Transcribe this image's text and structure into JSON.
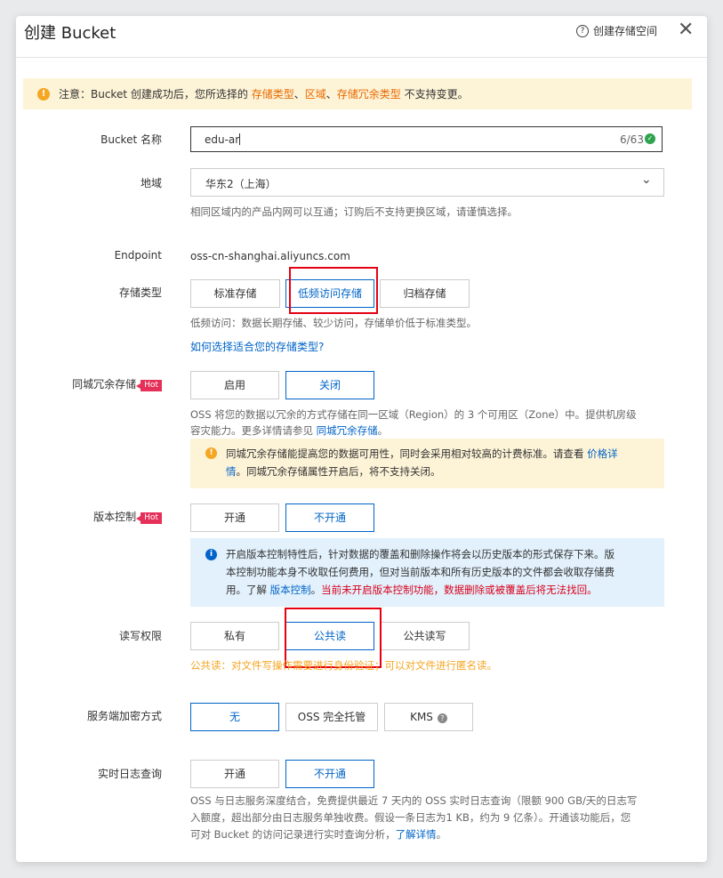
{
  "header": {
    "title": "创建 Bucket",
    "help_icon_glyph": "?",
    "help_label": "创建存储空间",
    "close_glyph": "✕"
  },
  "notice": {
    "prefix": "注意：Bucket 创建成功后，您所选择的 ",
    "field1": "存储类型",
    "sep1": "、",
    "field2": "区域",
    "sep2": "、",
    "field3": "存储冗余类型",
    "suffix": " 不支持变更。"
  },
  "bucket_name": {
    "label": "Bucket 名称",
    "value": "edu-ar",
    "count": "6/63"
  },
  "region": {
    "label": "地域",
    "value": "华东2（上海）",
    "hint": "相同区域内的产品内网可以互通；订购后不支持更换区域，请谨慎选择。"
  },
  "endpoint": {
    "label": "Endpoint",
    "value": "oss-cn-shanghai.aliyuncs.com"
  },
  "storage_class": {
    "label": "存储类型",
    "options": [
      "标准存储",
      "低频访问存储",
      "归档存储"
    ],
    "selected": "低频访问存储",
    "hint": "低频访问：数据长期存储、较少访问，存储单价低于标准类型。",
    "link": "如何选择适合您的存储类型?"
  },
  "redundancy": {
    "label": "同城冗余存储",
    "badge": "Hot",
    "options": [
      "启用",
      "关闭"
    ],
    "selected": "关闭",
    "desc_line1": "OSS 将您的数据以冗余的方式存储在同一区域（Region）的 3 个可用区（Zone）中。提供机房级",
    "desc_line2": "容灾能力。更多详情请参见 ",
    "desc_link": "同城冗余存储",
    "desc_end": "。",
    "tip_line1": "同城冗余存储能提高您的数据可用性，同时会采用相对较高的计费标准。请查看 ",
    "tip_link_a": "价格详",
    "tip_link_b": "情",
    "tip_line2_rest": "。同城冗余存储属性开启后，将不支持关闭。"
  },
  "versioning": {
    "label": "版本控制",
    "badge": "Hot",
    "options": [
      "开通",
      "不开通"
    ],
    "selected": "不开通",
    "info_line1": "开启版本控制特性后，针对数据的覆盖和删除操作将会以历史版本的形式保存下来。版",
    "info_line2": "本控制功能本身不收取任何费用，但对当前版本和所有历史版本的文件都会收取存储费",
    "info_line3_a": "用。了解 ",
    "info_link": "版本控制",
    "info_end": "。",
    "info_red": "当前未开启版本控制功能，数据删除或被覆盖后将无法找回。"
  },
  "acl": {
    "label": "读写权限",
    "options": [
      "私有",
      "公共读",
      "公共读写"
    ],
    "selected": "公共读",
    "warning": "公共读：对文件写操作需要进行身份验证；可以对文件进行匿名读。"
  },
  "encryption": {
    "label": "服务端加密方式",
    "options": [
      "无",
      "OSS 完全托管",
      "KMS"
    ],
    "selected": "无",
    "help_glyph": "?"
  },
  "realtime_log": {
    "label": "实时日志查询",
    "options": [
      "开通",
      "不开通"
    ],
    "selected": "不开通",
    "desc_line1": "OSS 与日志服务深度结合，免费提供最近 7 天内的 OSS 实时日志查询（限额 900 GB/天的日志写",
    "desc_line2": "入额度，超出部分由日志服务单独收费。假设一条日志为1 KB，约为 9 亿条）。开通该功能后，您",
    "desc_line3": "可对 Bucket 的访问记录进行实时查询分析，",
    "desc_link": "了解详情",
    "desc_end": "。"
  }
}
